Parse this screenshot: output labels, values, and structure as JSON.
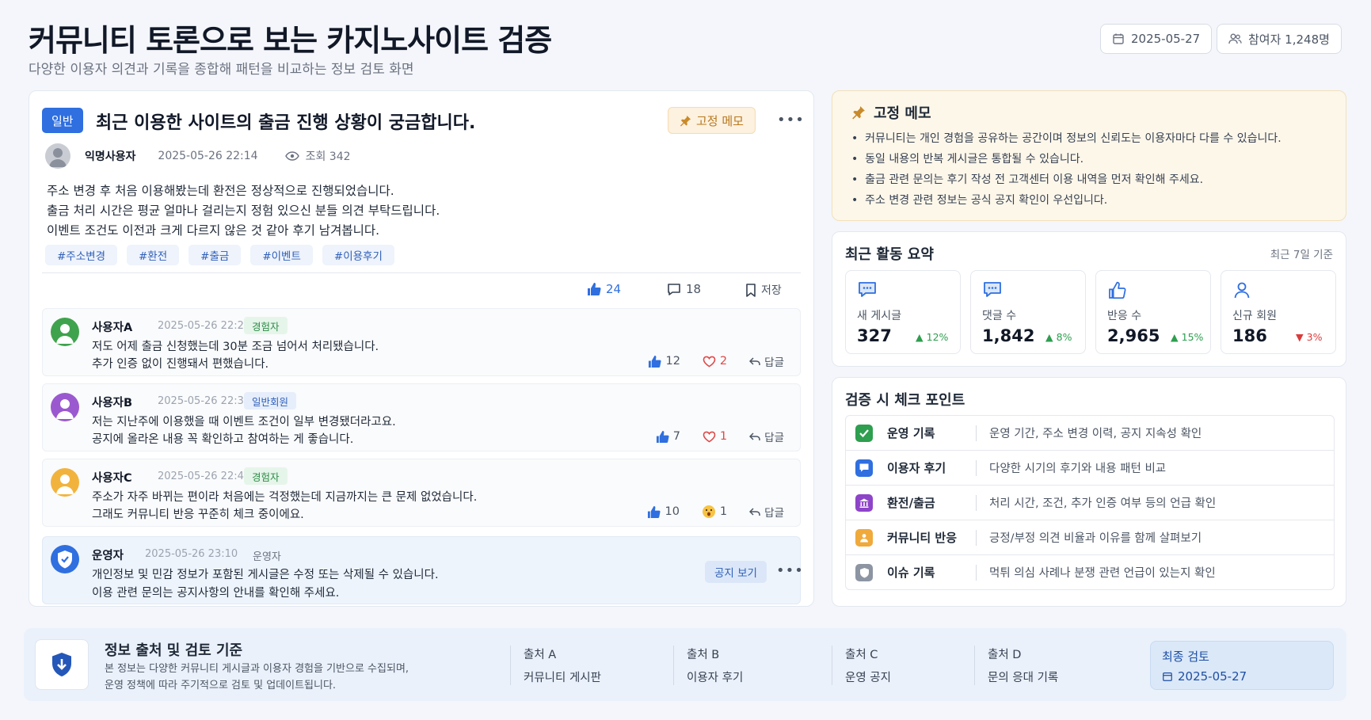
{
  "header": {
    "title": "커뮤니티 토론으로 보는 카지노사이트 검증",
    "subtitle": "다양한 이용자 의견과 기록을 종합해 패턴을 비교하는 정보 검토 화면",
    "date": "2025-05-27",
    "participants": "참여자 1,248명"
  },
  "post": {
    "category": "일반",
    "title": "최근 이용한 사이트의 출금 진행 상황이 궁금합니다.",
    "pin_label": "고정 메모",
    "author": "익명사용자",
    "time": "2025-05-26 22:14",
    "views": "조회 342",
    "body": [
      "주소 변경 후 처음 이용해봤는데 환전은 정상적으로 진행되었습니다.",
      "출금 처리 시간은 평균 얼마나 걸리는지 정험 있으신 분들 의견 부탁드립니다.",
      "이벤트 조건도 이전과 크게 다르지 않은 것 같아 후기 남겨봅니다."
    ],
    "tags": [
      "#주소변경",
      "#환전",
      "#출금",
      "#이벤트",
      "#이용후기"
    ],
    "likes": "24",
    "comments_count": "18",
    "save_label": "저장"
  },
  "comments": [
    {
      "name": "사용자A",
      "time": "2025-05-26 22:28",
      "badge": "경험자",
      "lines": [
        "저도 어제 출금 신청했는데 30분 조금 넘어서 처리됐습니다.",
        "추가 인증 없이 진행돼서 편했습니다."
      ],
      "likes": "12",
      "reaction": "2",
      "reply": "답글",
      "avatar_color": "#3fa34d"
    },
    {
      "name": "사용자B",
      "time": "2025-05-26 22:35",
      "badge": "일반회원",
      "lines": [
        "저는 지난주에 이용했을 때 이벤트 조건이 일부 변경됐더라고요.",
        "공지에 올라온 내용 꼭 확인하고 참여하는 게 좋습니다."
      ],
      "likes": "7",
      "reaction": "1",
      "reply": "답글",
      "avatar_color": "#9b59d0"
    },
    {
      "name": "사용자C",
      "time": "2025-05-26 22:47",
      "badge": "경험자",
      "lines": [
        "주소가 자주 바뀌는 편이라 처음에는 걱정했는데 지금까지는 큰 문제 없었습니다.",
        "그래도 커뮤니티 반응 꾸준히 체크 중이에요."
      ],
      "likes": "10",
      "reaction": "1",
      "reply": "답글",
      "avatar_color": "#f2b33d"
    }
  ],
  "operator": {
    "name": "운영자",
    "time": "2025-05-26 23:10",
    "role": "운영자",
    "lines": [
      "개인정보 및 민감 정보가 포함된 게시글은 수정 또는 삭제될 수 있습니다.",
      "이용 관련 문의는 공지사항의 안내를 확인해 주세요."
    ],
    "notice_button": "공지 보기"
  },
  "memo": {
    "title": "고정 메모",
    "items": [
      "커뮤니티는 개인 경험을 공유하는 공간이며 정보의 신뢰도는 이용자마다 다를 수 있습니다.",
      "동일 내용의 반복 게시글은 통합될 수 있습니다.",
      "출금 관련 문의는 후기 작성 전 고객센터 이용 내역을 먼저 확인해 주세요.",
      "주소 변경 관련 정보는 공식 공지 확인이 우선입니다."
    ]
  },
  "summary": {
    "title": "최근 활동 요약",
    "period": "최근 7일 기준",
    "stats": [
      {
        "label": "새 게시글",
        "value": "327",
        "change": "12%",
        "trend": "up"
      },
      {
        "label": "댓글 수",
        "value": "1,842",
        "change": "8%",
        "trend": "up"
      },
      {
        "label": "반응 수",
        "value": "2,965",
        "change": "15%",
        "trend": "up"
      },
      {
        "label": "신규 회원",
        "value": "186",
        "change": "3%",
        "trend": "down"
      }
    ]
  },
  "checkpoints": {
    "title": "검증 시 체크 포인트",
    "rows": [
      {
        "key": "운영 기록",
        "value": "운영 기간, 주소 변경 이력, 공지 지속성 확인",
        "color": "#2e9e4f"
      },
      {
        "key": "이용자 후기",
        "value": "다양한 시기의 후기와 내용 패턴 비교",
        "color": "#2f6fe0"
      },
      {
        "key": "환전/출금",
        "value": "처리 시간, 조건, 추가 인증 여부 등의 언급 확인",
        "color": "#8e44c9"
      },
      {
        "key": "커뮤니티 반응",
        "value": "긍정/부정 의견 비율과 이유를 함께 살펴보기",
        "color": "#f0a93b"
      },
      {
        "key": "이슈 기록",
        "value": "먹튀 의심 사례나 분쟁 관련 언급이 있는지 확인",
        "color": "#8d95a3"
      }
    ]
  },
  "footer": {
    "title": "정보 출처 및 검토 기준",
    "desc": [
      "본 정보는 다양한 커뮤니티 게시글과 이용자 경험을 기반으로 수집되며,",
      "운영 정책에 따라 주기적으로 검토 및 업데이트됩니다."
    ],
    "sources": [
      {
        "key": "출처 A",
        "value": "커뮤니티 게시판"
      },
      {
        "key": "출처 B",
        "value": "이용자 후기"
      },
      {
        "key": "출처 C",
        "value": "운영 공지"
      },
      {
        "key": "출처 D",
        "value": "문의 응대 기록"
      }
    ],
    "final_label": "최종 검토",
    "final_date": "2025-05-27"
  }
}
